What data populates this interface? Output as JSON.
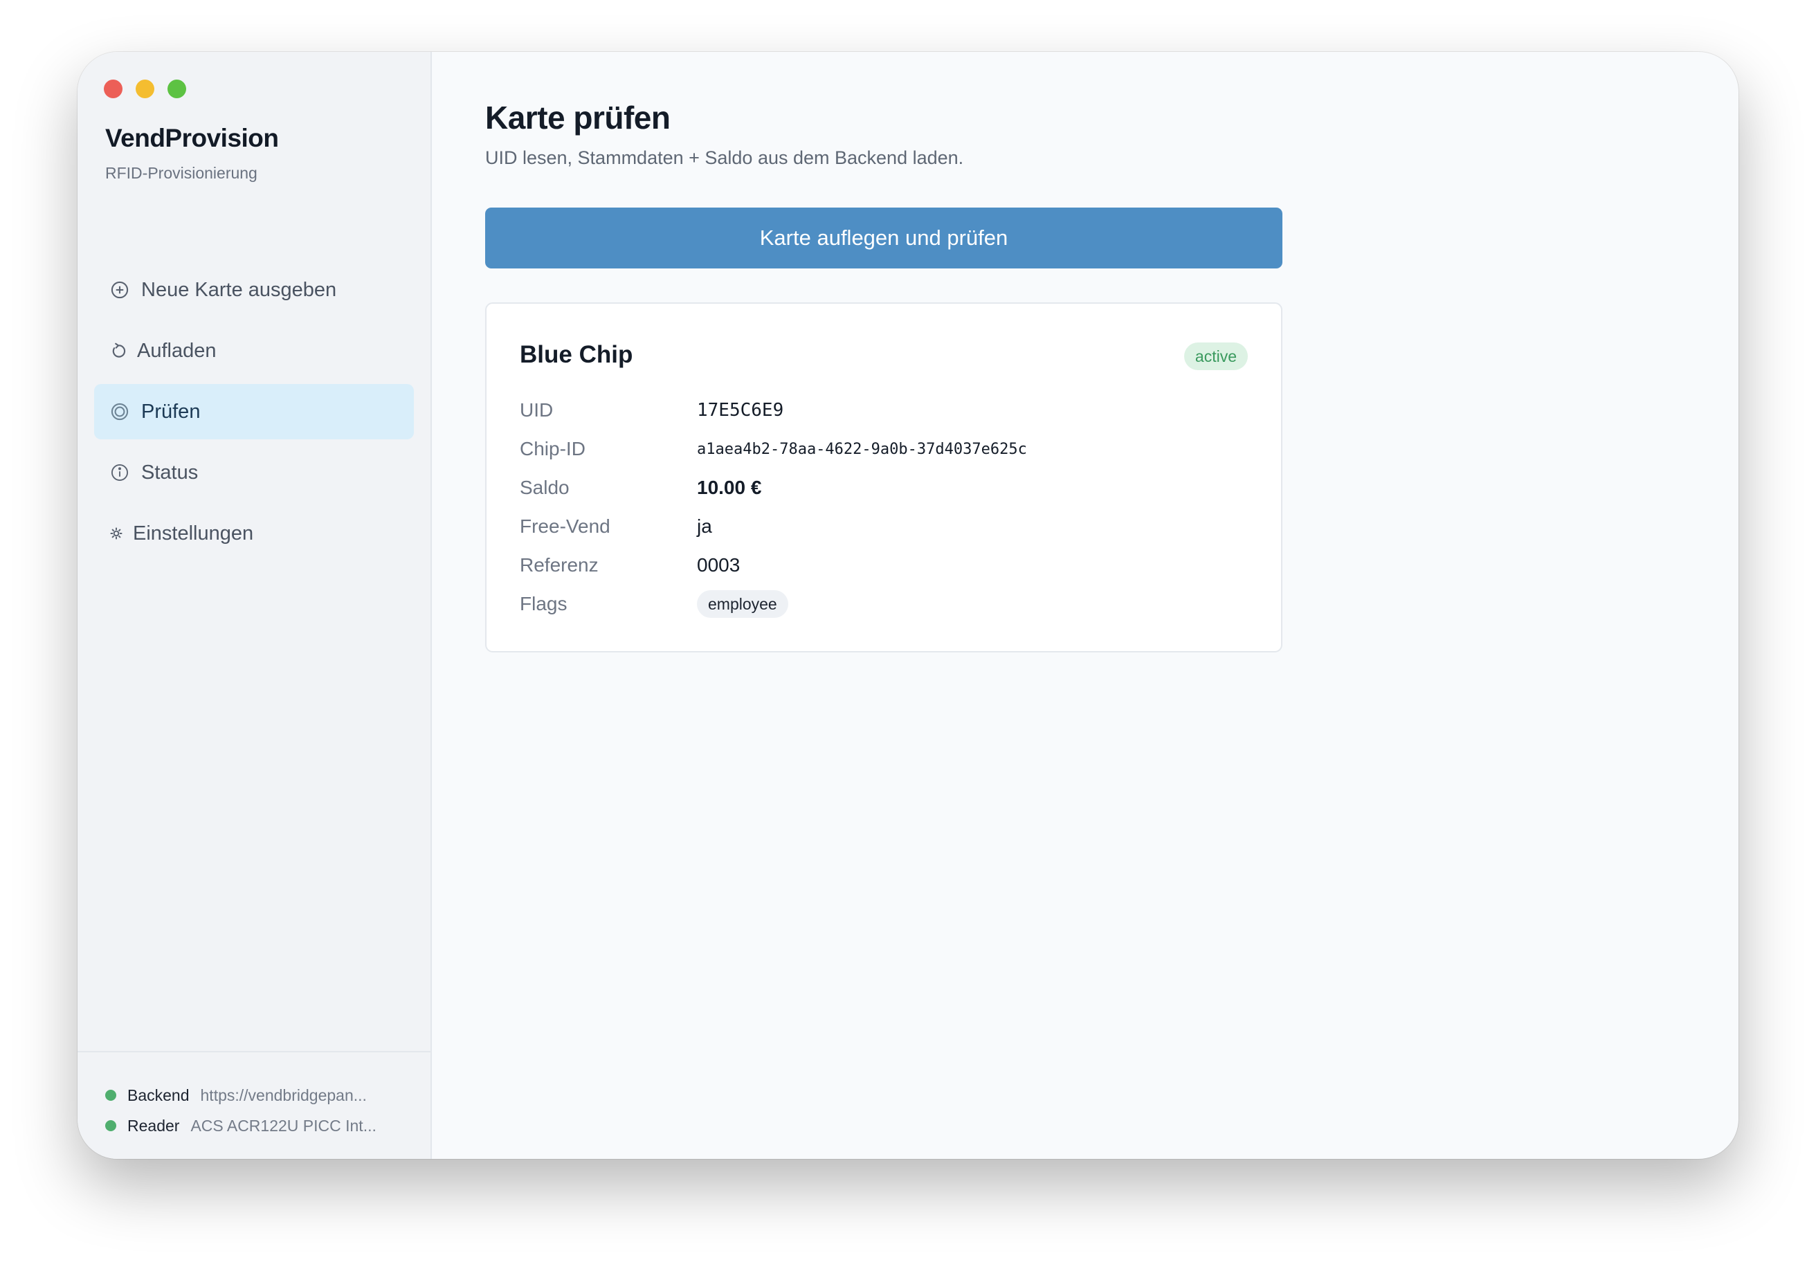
{
  "app": {
    "name": "VendProvision",
    "subtitle": "RFID-Provisionierung"
  },
  "sidebar": {
    "items": [
      {
        "label": "Neue Karte ausgeben",
        "icon": "plus-circle-icon"
      },
      {
        "label": "Aufladen",
        "icon": "refresh-icon"
      },
      {
        "label": "Prüfen",
        "icon": "target-icon",
        "active": true
      },
      {
        "label": "Status",
        "icon": "info-icon"
      },
      {
        "label": "Einstellungen",
        "icon": "gear-icon"
      }
    ],
    "footer": {
      "backend_label": "Backend",
      "backend_value": "https://vendbridgepan...",
      "reader_label": "Reader",
      "reader_value": "ACS ACR122U PICC Int...",
      "status_color": "#4fae6e"
    }
  },
  "main": {
    "title": "Karte prüfen",
    "subtitle": "UID lesen, Stammdaten + Saldo aus dem Backend laden.",
    "primary_button": "Karte auflegen und prüfen",
    "accent_color": "#4e8ec4",
    "card": {
      "title": "Blue Chip",
      "status_badge": "active",
      "fields": {
        "uid_label": "UID",
        "uid_value": "17E5C6E9",
        "chip_id_label": "Chip-ID",
        "chip_id_value": "a1aea4b2-78aa-4622-9a0b-37d4037e625c",
        "saldo_label": "Saldo",
        "saldo_value": "10.00 €",
        "free_vend_label": "Free-Vend",
        "free_vend_value": "ja",
        "referenz_label": "Referenz",
        "referenz_value": "0003",
        "flags_label": "Flags",
        "flags_value": "employee"
      }
    }
  }
}
